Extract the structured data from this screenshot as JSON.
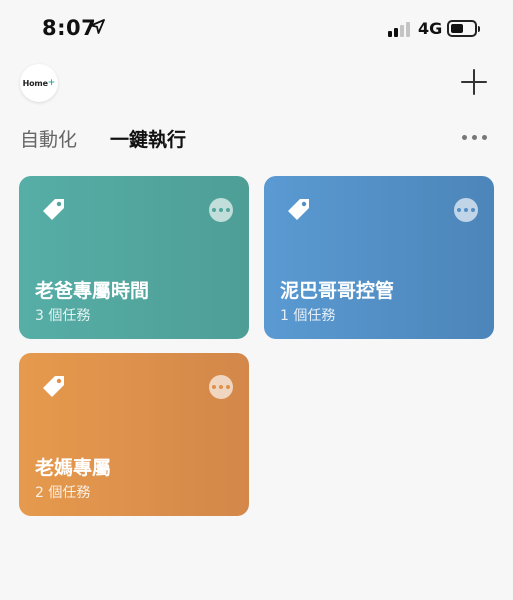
{
  "status_bar": {
    "time": "8:07",
    "network": "4G",
    "icons": [
      "location-arrow-icon",
      "signal-bars-icon",
      "battery-icon"
    ]
  },
  "header": {
    "logo_text": "Home",
    "logo_plus": "+",
    "add_icon": "plus-icon"
  },
  "tabs": [
    {
      "label": "自動化",
      "active": false
    },
    {
      "label": "一鍵執行",
      "active": true
    }
  ],
  "cards": [
    {
      "title": "老爸專屬時間",
      "subtitle": "3 個任務",
      "color": "#56aea6",
      "icon": "tag-icon"
    },
    {
      "title": "泥巴哥哥控管",
      "subtitle": "1 個任務",
      "color": "#5a9ad2",
      "icon": "tag-icon"
    },
    {
      "title": "老媽專屬",
      "subtitle": "2 個任務",
      "color": "#e69a4d",
      "icon": "tag-icon"
    }
  ]
}
